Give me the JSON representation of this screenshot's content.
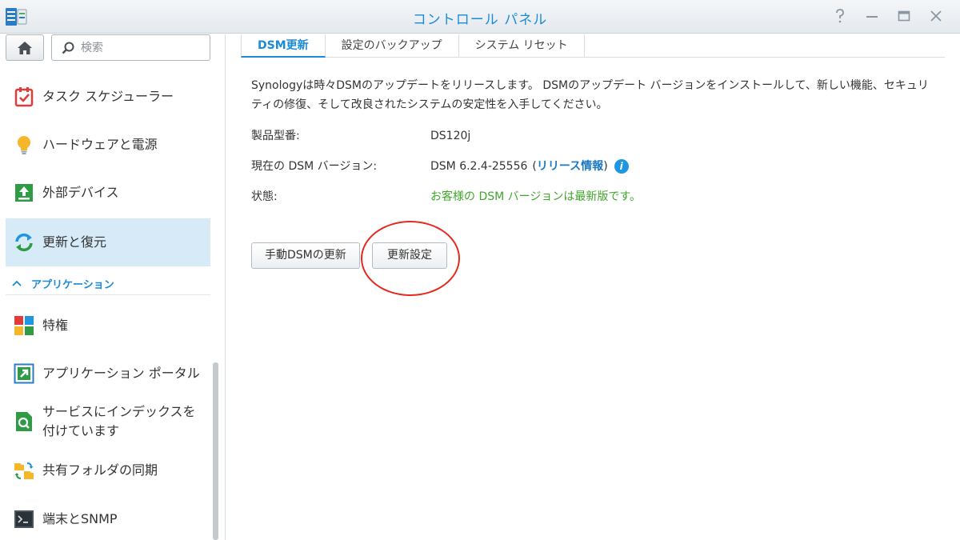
{
  "window": {
    "title": "コントロール パネル"
  },
  "titlebar_buttons": [
    "help",
    "minimize",
    "maximize",
    "close"
  ],
  "sidebar": {
    "search_placeholder": "検索",
    "items": [
      {
        "label": "タスク スケジューラー",
        "icon": "task-scheduler-icon"
      },
      {
        "label": "ハードウェアと電源",
        "icon": "lightbulb-icon"
      },
      {
        "label": "外部デバイス",
        "icon": "external-device-icon"
      },
      {
        "label": "更新と復元",
        "icon": "update-restore-icon",
        "active": true
      }
    ],
    "section": {
      "label": "アプリケーション"
    },
    "apps": [
      {
        "label": "特権",
        "icon": "privileges-icon"
      },
      {
        "label": "アプリケーション ポータル",
        "icon": "app-portal-icon"
      },
      {
        "label": "サービスにインデックスを\n付けています",
        "icon": "indexing-service-icon"
      },
      {
        "label": "共有フォルダの同期",
        "icon": "shared-folder-sync-icon"
      },
      {
        "label": "端末とSNMP",
        "icon": "terminal-icon"
      }
    ]
  },
  "tabs": [
    {
      "label": "DSM更新",
      "active": true
    },
    {
      "label": "設定のバックアップ"
    },
    {
      "label": "システム リセット"
    }
  ],
  "content": {
    "description": "Synologyは時々DSMのアップデートをリリースします。 DSMのアップデート バージョンをインストールして、新しい機能、セキュリティの修復、そして改良されたシステムの安定性を入手してください。",
    "model_label": "製品型番:",
    "model_value": "DS120j",
    "version_label": "現在の DSM バージョン:",
    "version_value": "DSM 6.2.4-25556",
    "version_open": "(",
    "release_notes_link": "リリース情報",
    "version_close": ")",
    "status_label": "状態:",
    "status_value": "お客様の DSM バージョンは最新版です。",
    "manual_update_button": "手動DSMの更新",
    "update_settings_button": "更新設定"
  },
  "colors": {
    "accent": "#1a8bd6",
    "active_bg": "#d6eaf8",
    "status_ok": "#3fa62a",
    "annotation": "#e52a1d"
  }
}
